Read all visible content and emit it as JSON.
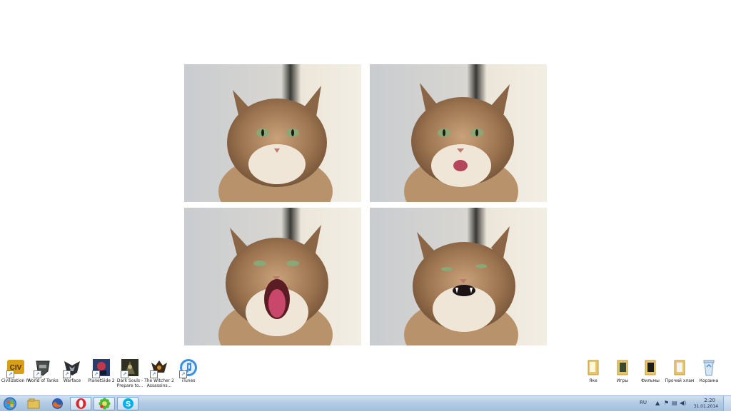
{
  "wallpaper": {
    "photos": [
      {
        "id": "p1",
        "mood": "calm"
      },
      {
        "id": "p2",
        "mood": "tongue"
      },
      {
        "id": "p3",
        "mood": "yawn"
      },
      {
        "id": "p4",
        "mood": "hiss"
      }
    ]
  },
  "desktop_icons_left": [
    {
      "label": "Civilization IV",
      "icon": "civ-icon",
      "accent": "#d8a019"
    },
    {
      "label": "World of Tanks",
      "icon": "tank-icon",
      "accent": "#4a4f4d"
    },
    {
      "label": "Warface",
      "icon": "warface-icon",
      "accent": "#2b2e33"
    },
    {
      "label": "PlanetSide 2",
      "icon": "planetside-icon",
      "accent": "#2a3c6e"
    },
    {
      "label": "Dark Souls - Prepare to...",
      "icon": "dark-souls-icon",
      "accent": "#2f3022"
    },
    {
      "label": "The Witcher 2 Assassins...",
      "icon": "witcher-icon",
      "accent": "#3a2a1a"
    },
    {
      "label": "iTunes",
      "icon": "itunes-icon",
      "accent": "#3c8ee0"
    }
  ],
  "desktop_icons_right": [
    {
      "label": "Яке",
      "icon": "folder-icon"
    },
    {
      "label": "Игры",
      "icon": "folder-games-icon"
    },
    {
      "label": "Фильмы",
      "icon": "folder-movies-icon"
    },
    {
      "label": "Прочий хлам",
      "icon": "folder-misc-icon"
    },
    {
      "label": "Корзина",
      "icon": "recycle-bin-icon"
    }
  ],
  "taskbar": {
    "start_label": "Start",
    "pinned": [
      {
        "name": "explorer-icon"
      },
      {
        "name": "firefox-icon"
      },
      {
        "name": "opera-icon"
      },
      {
        "name": "icq-icon"
      },
      {
        "name": "skype-icon"
      }
    ],
    "tray": {
      "language": "RU",
      "time": "2:20",
      "date": "31.01.2014"
    }
  }
}
